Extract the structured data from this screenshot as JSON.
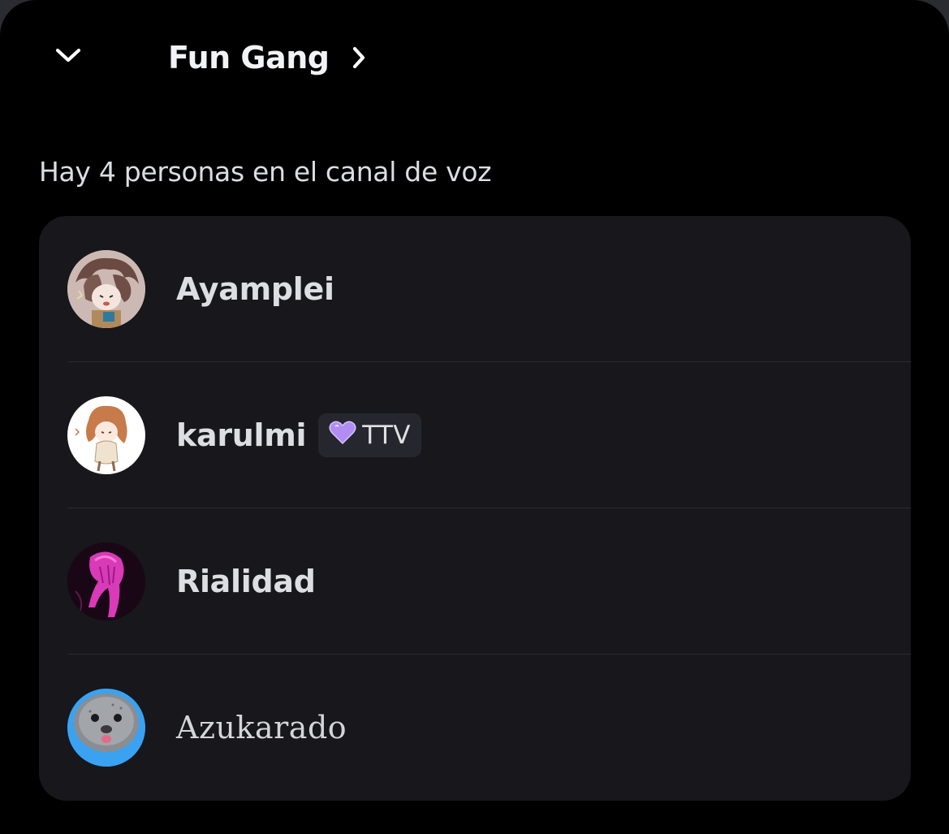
{
  "header": {
    "collapse_icon": "chevron-down-icon",
    "title": "Fun Gang",
    "title_icon": "chevron-right-icon"
  },
  "voice": {
    "count_text": "Hay 4 personas en el canal de voz"
  },
  "members": [
    {
      "name": "Ayamplei",
      "avatar": "anime-boy-avatar"
    },
    {
      "name": "karulmi",
      "avatar": "anime-girl-avatar",
      "tag": {
        "icon": "purple-heart-icon",
        "text": "TTV",
        "color": "#b08cf0"
      }
    },
    {
      "name": "Rialidad",
      "avatar": "pink-hair-avatar"
    },
    {
      "name": "Azukarado",
      "avatar": "seal-avatar",
      "font_style": "monospace-like"
    }
  ],
  "colors": {
    "background": "#000000",
    "card": "#17171c",
    "text_primary": "#f2f3f5",
    "text_secondary": "#dbdee1",
    "divider": "#2a2a31",
    "badge_bg": "#26272e"
  }
}
